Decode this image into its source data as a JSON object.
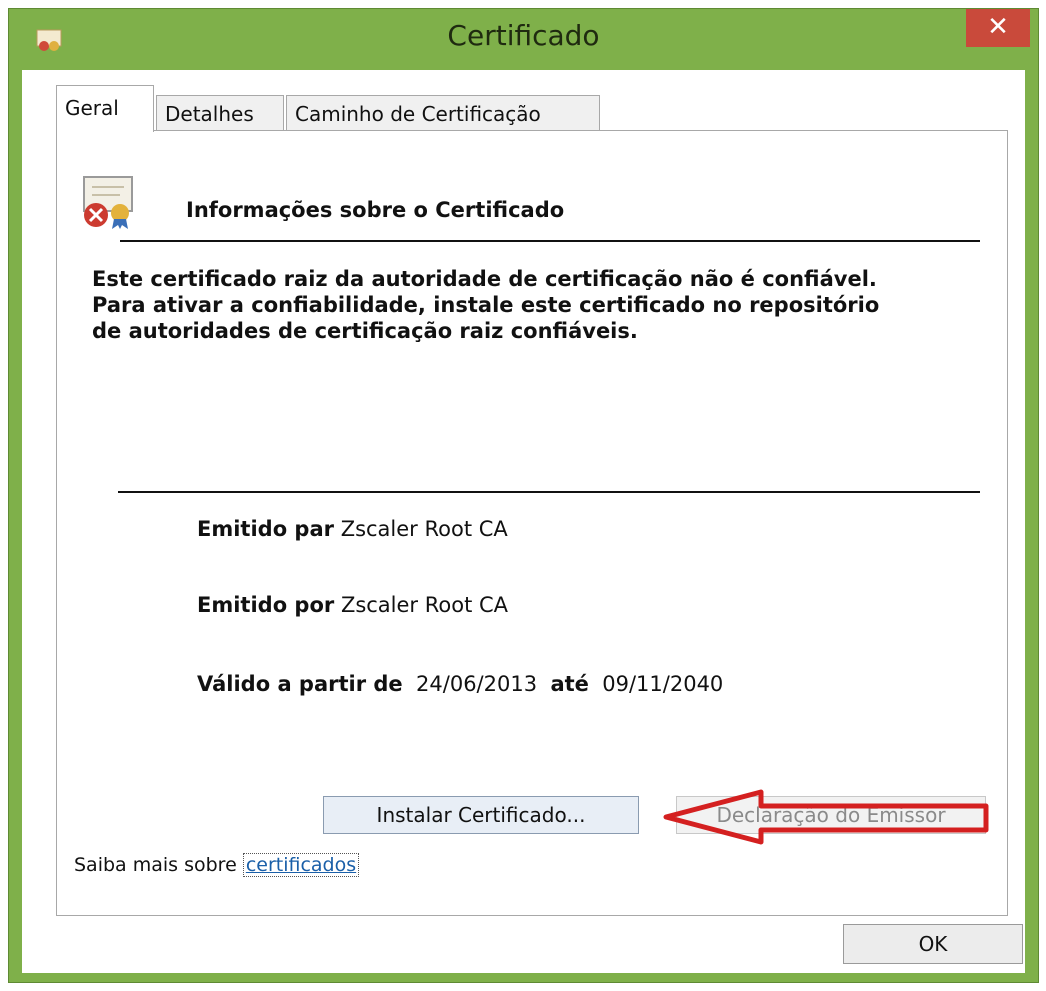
{
  "window": {
    "title": "Certificado",
    "close_label": "✕",
    "accent_color": "#7fb04a",
    "close_color": "#c94a3b"
  },
  "tabs": [
    {
      "label": "Geral",
      "active": true
    },
    {
      "label": "Detalhes",
      "active": false
    },
    {
      "label": "Caminho de Certificação",
      "active": false
    }
  ],
  "general": {
    "heading": "Informações sobre o Certificado",
    "warning": "Este certificado raiz da autoridade de certificação não é confiável. Para ativar a confiabilidade, instale este certificado no repositório de autoridades de certificação raiz confiáveis.",
    "issued_to_label": "Emitido par",
    "issued_to_value": "Zscaler Root CA",
    "issued_by_label": "Emitido por",
    "issued_by_value": "Zscaler Root CA",
    "valid_from_label": "Válido a partir de",
    "valid_from_value": "24/06/2013",
    "valid_to_label": "até",
    "valid_to_value": "09/11/2040"
  },
  "buttons": {
    "install": "Instalar Certificado...",
    "issuer": "Declaração do Emissor",
    "ok": "OK"
  },
  "footer": {
    "learn_more_prefix": "Saiba mais sobre",
    "learn_more_link": "certificados"
  },
  "icons": {
    "app": "certificate-icon",
    "certificate": "certificate-error-icon",
    "annotation": "red-arrow-annotation"
  }
}
